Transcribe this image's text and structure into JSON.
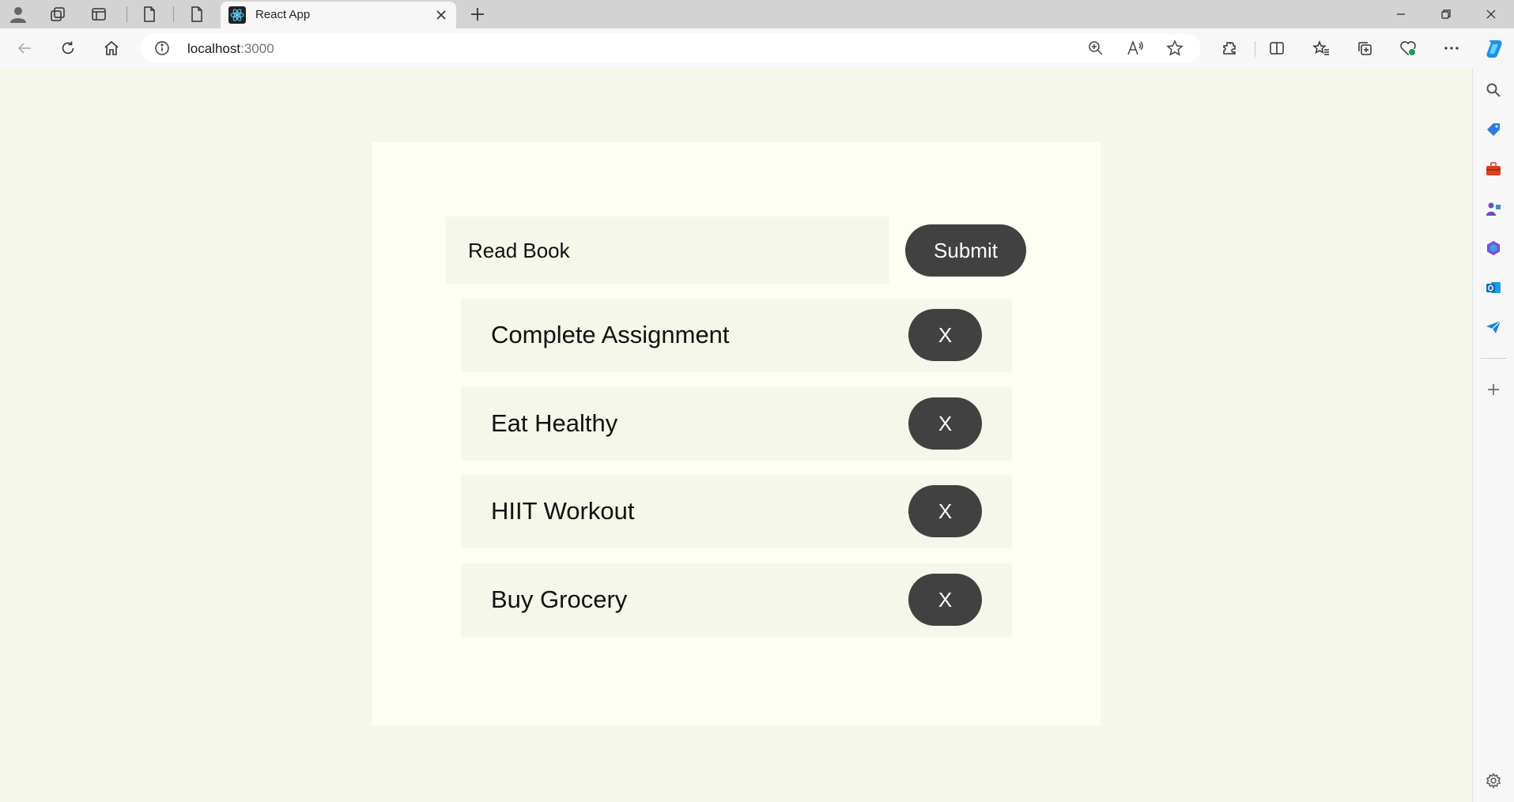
{
  "browser": {
    "tab": {
      "title": "React App"
    },
    "address": {
      "host": "localhost",
      "port": ":3000"
    }
  },
  "app": {
    "input": {
      "value": "Read Book"
    },
    "submit_label": "Submit",
    "todos": [
      {
        "label": "Complete Assignment",
        "delete_label": "X"
      },
      {
        "label": "Eat Healthy",
        "delete_label": "X"
      },
      {
        "label": "HIIT Workout",
        "delete_label": "X"
      },
      {
        "label": "Buy Grocery",
        "delete_label": "X"
      }
    ]
  },
  "colors": {
    "page_background": "#f4f7ea",
    "card_background": "#fcfff1",
    "button": "#414141",
    "button_text": "#ffffff"
  }
}
